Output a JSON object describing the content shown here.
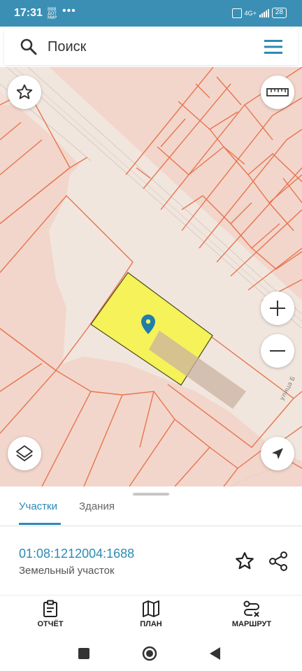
{
  "status_bar": {
    "time": "17:31",
    "carrier": "ВВВ ДОТ МИР",
    "dots": "•••",
    "network": "4G+",
    "battery": "28"
  },
  "search": {
    "placeholder": "Поиск"
  },
  "map": {
    "street_label": "улица Б"
  },
  "tabs": {
    "active": "Участки",
    "inactive": "Здания"
  },
  "parcel": {
    "number": "01:08:1212004:1688",
    "type": "Земельный участок"
  },
  "bottom_nav": {
    "report": "ОТЧЁТ",
    "plan": "ПЛАН",
    "route": "МАРШРУТ"
  },
  "colors": {
    "accent": "#2e8ab3",
    "status_bar": "#3b8fb5",
    "parcel_highlight": "#f5f25a",
    "map_background": "#f2d6cb",
    "parcel_lines": "#e8744f"
  }
}
